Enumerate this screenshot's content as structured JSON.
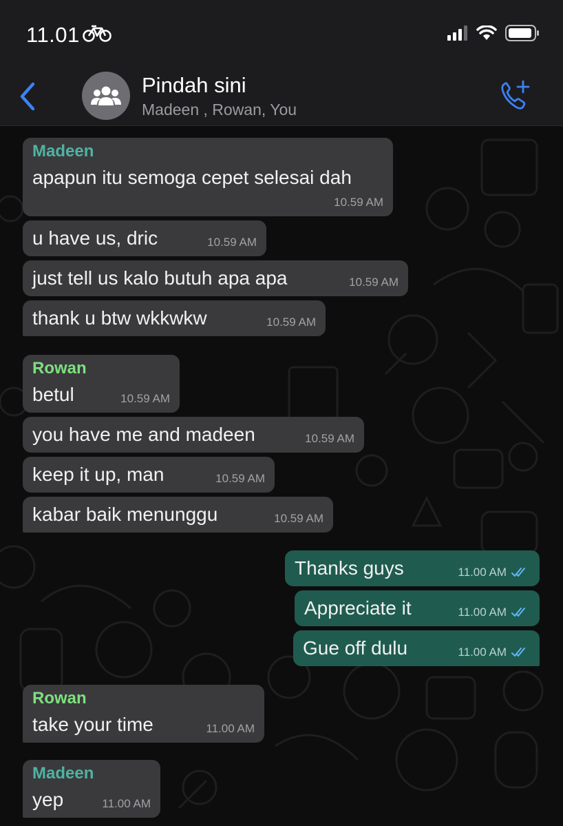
{
  "status": {
    "time": "11.01"
  },
  "header": {
    "title": "Pindah sini",
    "subtitle": "Madeen , Rowan, You"
  },
  "colors": {
    "madeen": "#4fb3a3",
    "rowan": "#7ee07f",
    "incoming": "#3a3a3c",
    "outgoing": "#1f5c4f",
    "accent": "#3b82f6"
  },
  "messages": [
    {
      "sender": "Madeen",
      "text": "apapun itu semoga cepet selesai dah",
      "time": "10.59 AM"
    },
    {
      "text": "u have us, dric",
      "time": "10.59 AM"
    },
    {
      "text": "just tell us kalo butuh apa apa",
      "time": "10.59 AM"
    },
    {
      "text": "thank u btw wkkwkw",
      "time": "10.59 AM"
    },
    {
      "sender": "Rowan",
      "text": "betul",
      "time": "10.59 AM"
    },
    {
      "text": "you have me and madeen",
      "time": "10.59 AM"
    },
    {
      "text": "keep it up, man",
      "time": "10.59 AM"
    },
    {
      "text": "kabar baik menunggu",
      "time": "10.59 AM"
    },
    {
      "text": "Thanks guys",
      "time": "11.00 AM"
    },
    {
      "text": "Appreciate it",
      "time": "11.00 AM"
    },
    {
      "text": "Gue off dulu",
      "time": "11.00 AM"
    },
    {
      "sender": "Rowan",
      "text": "take your time",
      "time": "11.00 AM"
    },
    {
      "sender": "Madeen",
      "text": "yep",
      "time": "11.00 AM"
    }
  ]
}
